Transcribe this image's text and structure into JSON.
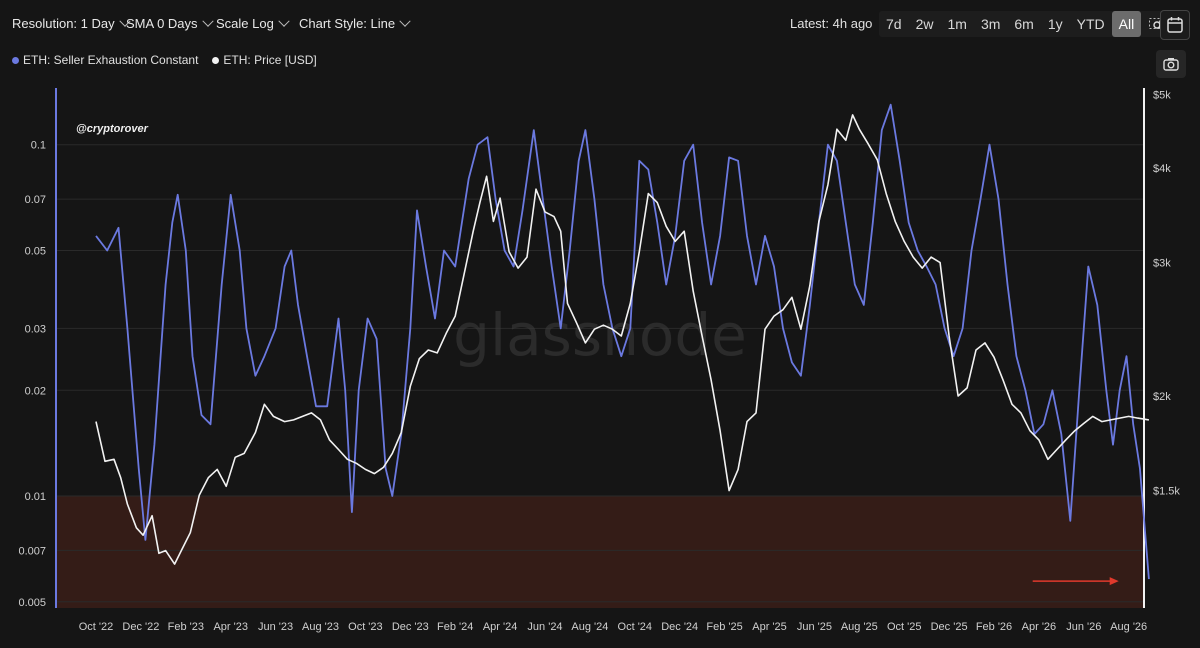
{
  "toolbar": {
    "resolution_label": "Resolution: 1 Day",
    "sma_label": "SMA 0 Days",
    "scale_label": "Scale Log",
    "style_label": "Chart Style: Line",
    "latest_label": "Latest: 4h ago",
    "ranges": [
      "7d",
      "2w",
      "1m",
      "3m",
      "6m",
      "1y",
      "YTD",
      "All"
    ],
    "active_range": "All",
    "calendar_icon": "calendar-icon",
    "zoom_icon": "zoom-select-icon",
    "camera_icon": "camera-icon"
  },
  "chart_data": {
    "type": "line",
    "watermark": "glassnode",
    "credit": "@cryptorover",
    "grid": true,
    "legend_position": "top-left",
    "x_ticks": [
      "Oct '22",
      "Dec '22",
      "Feb '23",
      "Apr '23",
      "Jun '23",
      "Aug '23",
      "Oct '23",
      "Dec '23",
      "Feb '24",
      "Apr '24",
      "Jun '24",
      "Aug '24",
      "Oct '24",
      "Dec '24",
      "Feb '25",
      "Apr '25",
      "Jun '25",
      "Aug '25",
      "Oct '25",
      "Dec '25",
      "Feb '26",
      "Apr '26",
      "Jun '26",
      "Aug '26"
    ],
    "left_axis": {
      "scale": "log",
      "ticks": [
        "0.005",
        "0.007",
        "0.01",
        "0.02",
        "0.03",
        "0.05",
        "0.07",
        "0.1"
      ],
      "tick_values": [
        0.005,
        0.007,
        0.01,
        0.02,
        0.03,
        0.05,
        0.07,
        0.1
      ],
      "range": [
        0.0048,
        0.145
      ]
    },
    "right_axis": {
      "scale": "log",
      "ticks": [
        "$1.5k",
        "$2k",
        "$3k",
        "$4k",
        "$5k"
      ],
      "tick_values": [
        1500,
        2000,
        3000,
        4000,
        5000
      ],
      "range": [
        1050,
        5100
      ]
    },
    "highlight_zone": {
      "from": 0.0048,
      "to": 0.01,
      "color": "#3a1d17"
    },
    "annotation": {
      "type": "arrow",
      "color": "#e0392c",
      "x": "Aug '26",
      "y": 0.0058
    },
    "series": [
      {
        "name": "ETH: Seller Exhaustion Constant",
        "color": "#6b79e0",
        "axis": "left",
        "points": [
          [
            0,
            0.055
          ],
          [
            0.25,
            0.05
          ],
          [
            0.5,
            0.058
          ],
          [
            0.7,
            0.03
          ],
          [
            0.95,
            0.012
          ],
          [
            1.1,
            0.0075
          ],
          [
            1.3,
            0.014
          ],
          [
            1.55,
            0.04
          ],
          [
            1.7,
            0.06
          ],
          [
            1.82,
            0.072
          ],
          [
            2.0,
            0.05
          ],
          [
            2.15,
            0.025
          ],
          [
            2.35,
            0.017
          ],
          [
            2.55,
            0.016
          ],
          [
            2.8,
            0.04
          ],
          [
            3.0,
            0.072
          ],
          [
            3.2,
            0.05
          ],
          [
            3.35,
            0.03
          ],
          [
            3.55,
            0.022
          ],
          [
            3.75,
            0.025
          ],
          [
            4.0,
            0.03
          ],
          [
            4.2,
            0.045
          ],
          [
            4.35,
            0.05
          ],
          [
            4.5,
            0.035
          ],
          [
            4.7,
            0.025
          ],
          [
            4.9,
            0.018
          ],
          [
            5.15,
            0.018
          ],
          [
            5.4,
            0.032
          ],
          [
            5.55,
            0.02
          ],
          [
            5.7,
            0.009
          ],
          [
            5.85,
            0.02
          ],
          [
            6.05,
            0.032
          ],
          [
            6.25,
            0.028
          ],
          [
            6.45,
            0.012
          ],
          [
            6.6,
            0.01
          ],
          [
            6.8,
            0.015
          ],
          [
            7.0,
            0.03
          ],
          [
            7.15,
            0.065
          ],
          [
            7.35,
            0.045
          ],
          [
            7.55,
            0.032
          ],
          [
            7.75,
            0.05
          ],
          [
            8.0,
            0.045
          ],
          [
            8.15,
            0.06
          ],
          [
            8.3,
            0.08
          ],
          [
            8.5,
            0.1
          ],
          [
            8.72,
            0.105
          ],
          [
            8.9,
            0.07
          ],
          [
            9.1,
            0.05
          ],
          [
            9.3,
            0.045
          ],
          [
            9.5,
            0.065
          ],
          [
            9.75,
            0.11
          ],
          [
            9.95,
            0.07
          ],
          [
            10.15,
            0.045
          ],
          [
            10.35,
            0.03
          ],
          [
            10.55,
            0.05
          ],
          [
            10.75,
            0.09
          ],
          [
            10.9,
            0.11
          ],
          [
            11.1,
            0.07
          ],
          [
            11.3,
            0.04
          ],
          [
            11.5,
            0.03
          ],
          [
            11.7,
            0.025
          ],
          [
            11.9,
            0.03
          ],
          [
            12.1,
            0.09
          ],
          [
            12.3,
            0.085
          ],
          [
            12.5,
            0.06
          ],
          [
            12.7,
            0.04
          ],
          [
            12.9,
            0.055
          ],
          [
            13.1,
            0.09
          ],
          [
            13.3,
            0.1
          ],
          [
            13.5,
            0.06
          ],
          [
            13.7,
            0.04
          ],
          [
            13.9,
            0.055
          ],
          [
            14.1,
            0.092
          ],
          [
            14.3,
            0.09
          ],
          [
            14.5,
            0.055
          ],
          [
            14.7,
            0.04
          ],
          [
            14.9,
            0.055
          ],
          [
            15.1,
            0.045
          ],
          [
            15.3,
            0.03
          ],
          [
            15.5,
            0.024
          ],
          [
            15.7,
            0.022
          ],
          [
            15.9,
            0.035
          ],
          [
            16.1,
            0.06
          ],
          [
            16.3,
            0.1
          ],
          [
            16.5,
            0.09
          ],
          [
            16.7,
            0.06
          ],
          [
            16.9,
            0.04
          ],
          [
            17.1,
            0.035
          ],
          [
            17.3,
            0.06
          ],
          [
            17.5,
            0.11
          ],
          [
            17.7,
            0.13
          ],
          [
            17.9,
            0.09
          ],
          [
            18.1,
            0.06
          ],
          [
            18.3,
            0.05
          ],
          [
            18.5,
            0.045
          ],
          [
            18.7,
            0.04
          ],
          [
            18.9,
            0.03
          ],
          [
            19.1,
            0.025
          ],
          [
            19.3,
            0.03
          ],
          [
            19.5,
            0.05
          ],
          [
            19.7,
            0.07
          ],
          [
            19.9,
            0.1
          ],
          [
            20.1,
            0.07
          ],
          [
            20.3,
            0.04
          ],
          [
            20.5,
            0.025
          ],
          [
            20.7,
            0.02
          ],
          [
            20.9,
            0.015
          ],
          [
            21.1,
            0.016
          ],
          [
            21.3,
            0.02
          ],
          [
            21.5,
            0.015
          ],
          [
            21.7,
            0.0085
          ],
          [
            21.9,
            0.02
          ],
          [
            22.1,
            0.045
          ],
          [
            22.3,
            0.035
          ],
          [
            22.5,
            0.02
          ],
          [
            22.65,
            0.014
          ],
          [
            22.8,
            0.02
          ],
          [
            22.95,
            0.025
          ],
          [
            23.1,
            0.016
          ],
          [
            23.25,
            0.012
          ],
          [
            23.45,
            0.0058
          ]
        ]
      },
      {
        "name": "ETH: Price [USD]",
        "color": "#f2f2f2",
        "axis": "right",
        "points": [
          [
            0,
            1850
          ],
          [
            0.2,
            1640
          ],
          [
            0.4,
            1650
          ],
          [
            0.55,
            1560
          ],
          [
            0.7,
            1440
          ],
          [
            0.9,
            1340
          ],
          [
            1.05,
            1310
          ],
          [
            1.25,
            1390
          ],
          [
            1.4,
            1240
          ],
          [
            1.55,
            1250
          ],
          [
            1.75,
            1200
          ],
          [
            1.9,
            1250
          ],
          [
            2.1,
            1320
          ],
          [
            2.3,
            1480
          ],
          [
            2.5,
            1560
          ],
          [
            2.7,
            1600
          ],
          [
            2.9,
            1520
          ],
          [
            3.1,
            1660
          ],
          [
            3.3,
            1680
          ],
          [
            3.55,
            1790
          ],
          [
            3.75,
            1950
          ],
          [
            3.95,
            1880
          ],
          [
            4.2,
            1850
          ],
          [
            4.4,
            1860
          ],
          [
            4.6,
            1880
          ],
          [
            4.8,
            1900
          ],
          [
            5.0,
            1860
          ],
          [
            5.2,
            1750
          ],
          [
            5.4,
            1700
          ],
          [
            5.6,
            1650
          ],
          [
            5.8,
            1630
          ],
          [
            6.0,
            1600
          ],
          [
            6.2,
            1580
          ],
          [
            6.4,
            1610
          ],
          [
            6.6,
            1680
          ],
          [
            6.8,
            1790
          ],
          [
            7.0,
            2060
          ],
          [
            7.2,
            2240
          ],
          [
            7.4,
            2300
          ],
          [
            7.6,
            2280
          ],
          [
            7.8,
            2420
          ],
          [
            8.0,
            2550
          ],
          [
            8.2,
            2900
          ],
          [
            8.4,
            3300
          ],
          [
            8.55,
            3600
          ],
          [
            8.7,
            3900
          ],
          [
            8.85,
            3400
          ],
          [
            9.0,
            3650
          ],
          [
            9.2,
            3100
          ],
          [
            9.4,
            2950
          ],
          [
            9.6,
            3050
          ],
          [
            9.8,
            3750
          ],
          [
            10.0,
            3500
          ],
          [
            10.2,
            3450
          ],
          [
            10.35,
            3300
          ],
          [
            10.5,
            2650
          ],
          [
            10.7,
            2500
          ],
          [
            10.9,
            2350
          ],
          [
            11.1,
            2450
          ],
          [
            11.3,
            2480
          ],
          [
            11.5,
            2450
          ],
          [
            11.7,
            2400
          ],
          [
            11.9,
            2650
          ],
          [
            12.1,
            3100
          ],
          [
            12.3,
            3700
          ],
          [
            12.5,
            3600
          ],
          [
            12.7,
            3350
          ],
          [
            12.9,
            3200
          ],
          [
            13.1,
            3300
          ],
          [
            13.3,
            2750
          ],
          [
            13.5,
            2400
          ],
          [
            13.7,
            2100
          ],
          [
            13.9,
            1800
          ],
          [
            14.1,
            1500
          ],
          [
            14.3,
            1600
          ],
          [
            14.5,
            1850
          ],
          [
            14.7,
            1900
          ],
          [
            14.9,
            2450
          ],
          [
            15.1,
            2550
          ],
          [
            15.3,
            2600
          ],
          [
            15.5,
            2700
          ],
          [
            15.7,
            2450
          ],
          [
            15.9,
            2800
          ],
          [
            16.1,
            3400
          ],
          [
            16.3,
            3800
          ],
          [
            16.5,
            4500
          ],
          [
            16.7,
            4350
          ],
          [
            16.85,
            4700
          ],
          [
            17.0,
            4500
          ],
          [
            17.2,
            4300
          ],
          [
            17.4,
            4100
          ],
          [
            17.6,
            3700
          ],
          [
            17.8,
            3400
          ],
          [
            18.0,
            3200
          ],
          [
            18.2,
            3050
          ],
          [
            18.4,
            2950
          ],
          [
            18.6,
            3050
          ],
          [
            18.8,
            3000
          ],
          [
            19.0,
            2400
          ],
          [
            19.2,
            2000
          ],
          [
            19.4,
            2050
          ],
          [
            19.6,
            2300
          ],
          [
            19.8,
            2350
          ],
          [
            20.0,
            2250
          ],
          [
            20.2,
            2100
          ],
          [
            20.4,
            1950
          ],
          [
            20.6,
            1900
          ],
          [
            20.8,
            1800
          ],
          [
            21.0,
            1750
          ],
          [
            21.2,
            1650
          ],
          [
            21.4,
            1700
          ],
          [
            21.6,
            1750
          ],
          [
            21.8,
            1800
          ],
          [
            22.0,
            1840
          ],
          [
            22.2,
            1880
          ],
          [
            22.4,
            1850
          ],
          [
            22.6,
            1860
          ],
          [
            22.8,
            1870
          ],
          [
            23.0,
            1880
          ],
          [
            23.2,
            1870
          ],
          [
            23.45,
            1860
          ]
        ]
      }
    ]
  }
}
